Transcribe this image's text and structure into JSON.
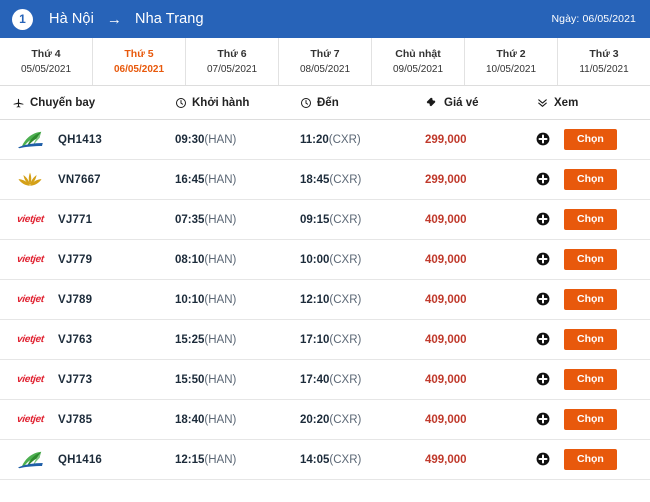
{
  "header": {
    "leg_number": "1",
    "origin": "Hà Nội",
    "arrow": "→",
    "destination": "Nha Trang",
    "date_label": "Ngày: 06/05/2021",
    "bg_color": "#2763b8"
  },
  "date_tabs": [
    {
      "dow": "Thứ 4",
      "date": "05/05/2021",
      "active": false
    },
    {
      "dow": "Thứ 5",
      "date": "06/05/2021",
      "active": true
    },
    {
      "dow": "Thứ 6",
      "date": "07/05/2021",
      "active": false
    },
    {
      "dow": "Thứ 7",
      "date": "08/05/2021",
      "active": false
    },
    {
      "dow": "Chủ nhật",
      "date": "09/05/2021",
      "active": false
    },
    {
      "dow": "Thứ 2",
      "date": "10/05/2021",
      "active": false
    },
    {
      "dow": "Thứ 3",
      "date": "11/05/2021",
      "active": false
    }
  ],
  "columns": {
    "flight": {
      "label": "Chuyến bay",
      "icon": "airplane-icon"
    },
    "departure": {
      "label": "Khởi hành",
      "icon": "clock-icon"
    },
    "arrival": {
      "label": "Đến",
      "icon": "clock-icon"
    },
    "price": {
      "label": "Giá vé",
      "icon": "ticket-icon"
    },
    "view": {
      "label": "Xem",
      "icon": "double-chevron-down-icon"
    }
  },
  "flights": [
    {
      "airline": "bamboo",
      "code": "QH1413",
      "dep_time": "09:30",
      "dep_airport": "(HAN)",
      "arr_time": "11:20",
      "arr_airport": "(CXR)",
      "price": "299,000",
      "add_icon": "plus-circle-icon",
      "choose_label": "Chọn"
    },
    {
      "airline": "vna",
      "code": "VN7667",
      "dep_time": "16:45",
      "dep_airport": "(HAN)",
      "arr_time": "18:45",
      "arr_airport": "(CXR)",
      "price": "299,000",
      "add_icon": "plus-circle-icon",
      "choose_label": "Chọn"
    },
    {
      "airline": "vietjet",
      "code": "VJ771",
      "dep_time": "07:35",
      "dep_airport": "(HAN)",
      "arr_time": "09:15",
      "arr_airport": "(CXR)",
      "price": "409,000",
      "add_icon": "plus-circle-icon",
      "choose_label": "Chọn"
    },
    {
      "airline": "vietjet",
      "code": "VJ779",
      "dep_time": "08:10",
      "dep_airport": "(HAN)",
      "arr_time": "10:00",
      "arr_airport": "(CXR)",
      "price": "409,000",
      "add_icon": "plus-circle-icon",
      "choose_label": "Chọn"
    },
    {
      "airline": "vietjet",
      "code": "VJ789",
      "dep_time": "10:10",
      "dep_airport": "(HAN)",
      "arr_time": "12:10",
      "arr_airport": "(CXR)",
      "price": "409,000",
      "add_icon": "plus-circle-icon",
      "choose_label": "Chọn"
    },
    {
      "airline": "vietjet",
      "code": "VJ763",
      "dep_time": "15:25",
      "dep_airport": "(HAN)",
      "arr_time": "17:10",
      "arr_airport": "(CXR)",
      "price": "409,000",
      "add_icon": "plus-circle-icon",
      "choose_label": "Chọn"
    },
    {
      "airline": "vietjet",
      "code": "VJ773",
      "dep_time": "15:50",
      "dep_airport": "(HAN)",
      "arr_time": "17:40",
      "arr_airport": "(CXR)",
      "price": "409,000",
      "add_icon": "plus-circle-icon",
      "choose_label": "Chọn"
    },
    {
      "airline": "vietjet",
      "code": "VJ785",
      "dep_time": "18:40",
      "dep_airport": "(HAN)",
      "arr_time": "20:20",
      "arr_airport": "(CXR)",
      "price": "409,000",
      "add_icon": "plus-circle-icon",
      "choose_label": "Chọn"
    },
    {
      "airline": "bamboo",
      "code": "QH1416",
      "dep_time": "12:15",
      "dep_airport": "(HAN)",
      "arr_time": "14:05",
      "arr_airport": "(CXR)",
      "price": "499,000",
      "add_icon": "plus-circle-icon",
      "choose_label": "Chọn"
    }
  ],
  "colors": {
    "header_blue": "#2763b8",
    "accent_orange": "#e8590c",
    "price_red": "#c0392b",
    "vietjet_red": "#e01f2e",
    "vna_gold": "#d4a017",
    "bamboo_green": "#3ca03c"
  }
}
